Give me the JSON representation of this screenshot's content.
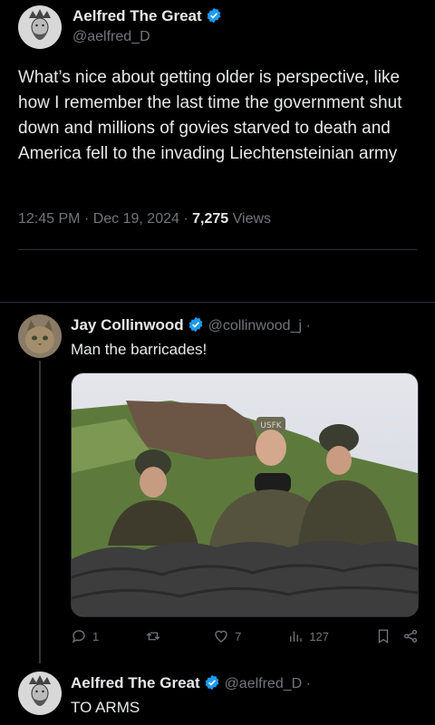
{
  "main_tweet": {
    "author_name": "Aelfred The Great",
    "author_handle": "@aelfred_D",
    "text": "What’s nice about getting older is perspective, like how I remember the last time the government shut down and millions of govies starved to death and America fell to the invading Liechtensteinian army",
    "time": "12:45 PM",
    "date": "Dec 19, 2024",
    "views_count": "7,275",
    "views_label": "Views",
    "separator": "·"
  },
  "reply_1": {
    "author_name": "Jay Collinwood",
    "author_handle": "@collinwood_j",
    "separator": "·",
    "text": "Man the barricades!",
    "image_caption": "USFK",
    "actions": {
      "replies": "1",
      "retweets": "",
      "likes": "7",
      "views": "127"
    }
  },
  "reply_2": {
    "author_name": "Aelfred The Great",
    "author_handle": "@aelfred_D",
    "separator": "·",
    "text": "TO ARMS"
  },
  "colors": {
    "background": "#000000",
    "text": "#e7e9ea",
    "secondary": "#71767b",
    "verified": "#1d9bf0",
    "divider": "#2f3336"
  },
  "icons": [
    "verified-badge-icon",
    "reply-icon",
    "retweet-icon",
    "like-icon",
    "views-icon",
    "bookmark-icon",
    "share-icon"
  ]
}
